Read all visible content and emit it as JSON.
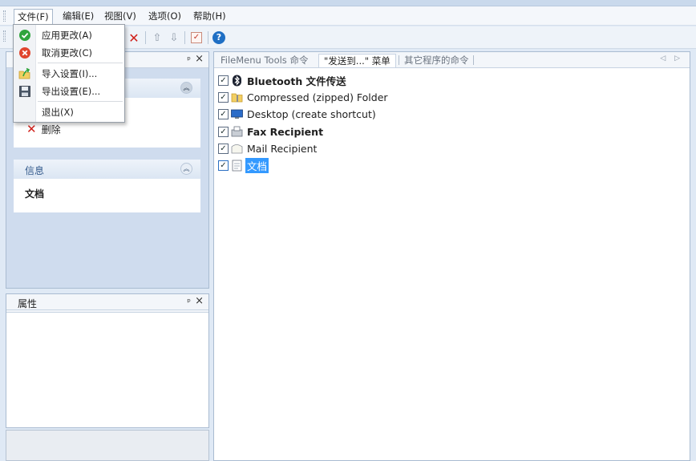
{
  "menu": {
    "file": "文件(F)",
    "edit": "编辑(E)",
    "view": "视图(V)",
    "options": "选项(O)",
    "help": "帮助(H)"
  },
  "file_menu": {
    "apply": "应用更改(A)",
    "cancel": "取消更改(C)",
    "import": "导入设置(I)...",
    "export": "导出设置(E)...",
    "exit": "退出(X)"
  },
  "toolbar": {
    "delete_glyph": "✕",
    "up_glyph": "⇧",
    "down_glyph": "⇩",
    "help_glyph": "?"
  },
  "left_pane": {
    "pin": "ᵖ",
    "close": "×",
    "tasks": {
      "delete_label": "删除"
    },
    "info": {
      "title": "信息",
      "text": "文档"
    }
  },
  "properties": {
    "title": "属性",
    "pin": "ᵖ",
    "close": "×"
  },
  "tabs": [
    {
      "label": "FileMenu Tools 命令"
    },
    {
      "label": "\"发送到...\" 菜单"
    },
    {
      "label": "其它程序的命令"
    }
  ],
  "tab_nav": "◁ ▷",
  "send_to_items": [
    {
      "label": "Bluetooth 文件传送",
      "icon": "bluetooth-icon",
      "bold": true
    },
    {
      "label": "Compressed (zipped) Folder",
      "icon": "zip-folder-icon",
      "bold": false
    },
    {
      "label": "Desktop (create shortcut)",
      "icon": "desktop-icon",
      "bold": false
    },
    {
      "label": "Fax Recipient",
      "icon": "fax-icon",
      "bold": true
    },
    {
      "label": "Mail Recipient",
      "icon": "mail-icon",
      "bold": false
    },
    {
      "label": "文档",
      "icon": "documents-icon",
      "bold": false,
      "selected": true
    }
  ],
  "colors": {
    "selection": "#3399ff",
    "delete_red": "#d0211b",
    "help_blue": "#1f6fc4",
    "pane_bg": "#cfdcee"
  }
}
